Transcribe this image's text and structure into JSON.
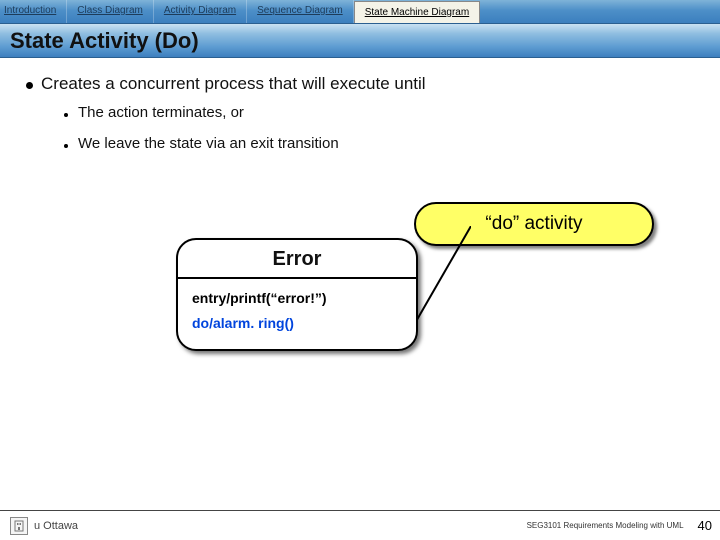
{
  "tabs": {
    "intro": "Introduction",
    "class": "Class Diagram",
    "activity": "Activity Diagram",
    "sequence": "Sequence Diagram",
    "statemachine": "State Machine Diagram"
  },
  "title": "State Activity (Do)",
  "main_bullet": "Creates a concurrent process that will execute until",
  "sub_bullets": {
    "a": "The action terminates, or",
    "b": "We leave the state via an exit transition"
  },
  "callout": "“do” activity",
  "state": {
    "name": "Error",
    "entry": "entry/printf(“error!”)",
    "do": "do/alarm. ring()"
  },
  "footer": {
    "logo_text": "u Ottawa",
    "course": "SEG3101  Requirements  Modeling with UML",
    "page": "40"
  }
}
